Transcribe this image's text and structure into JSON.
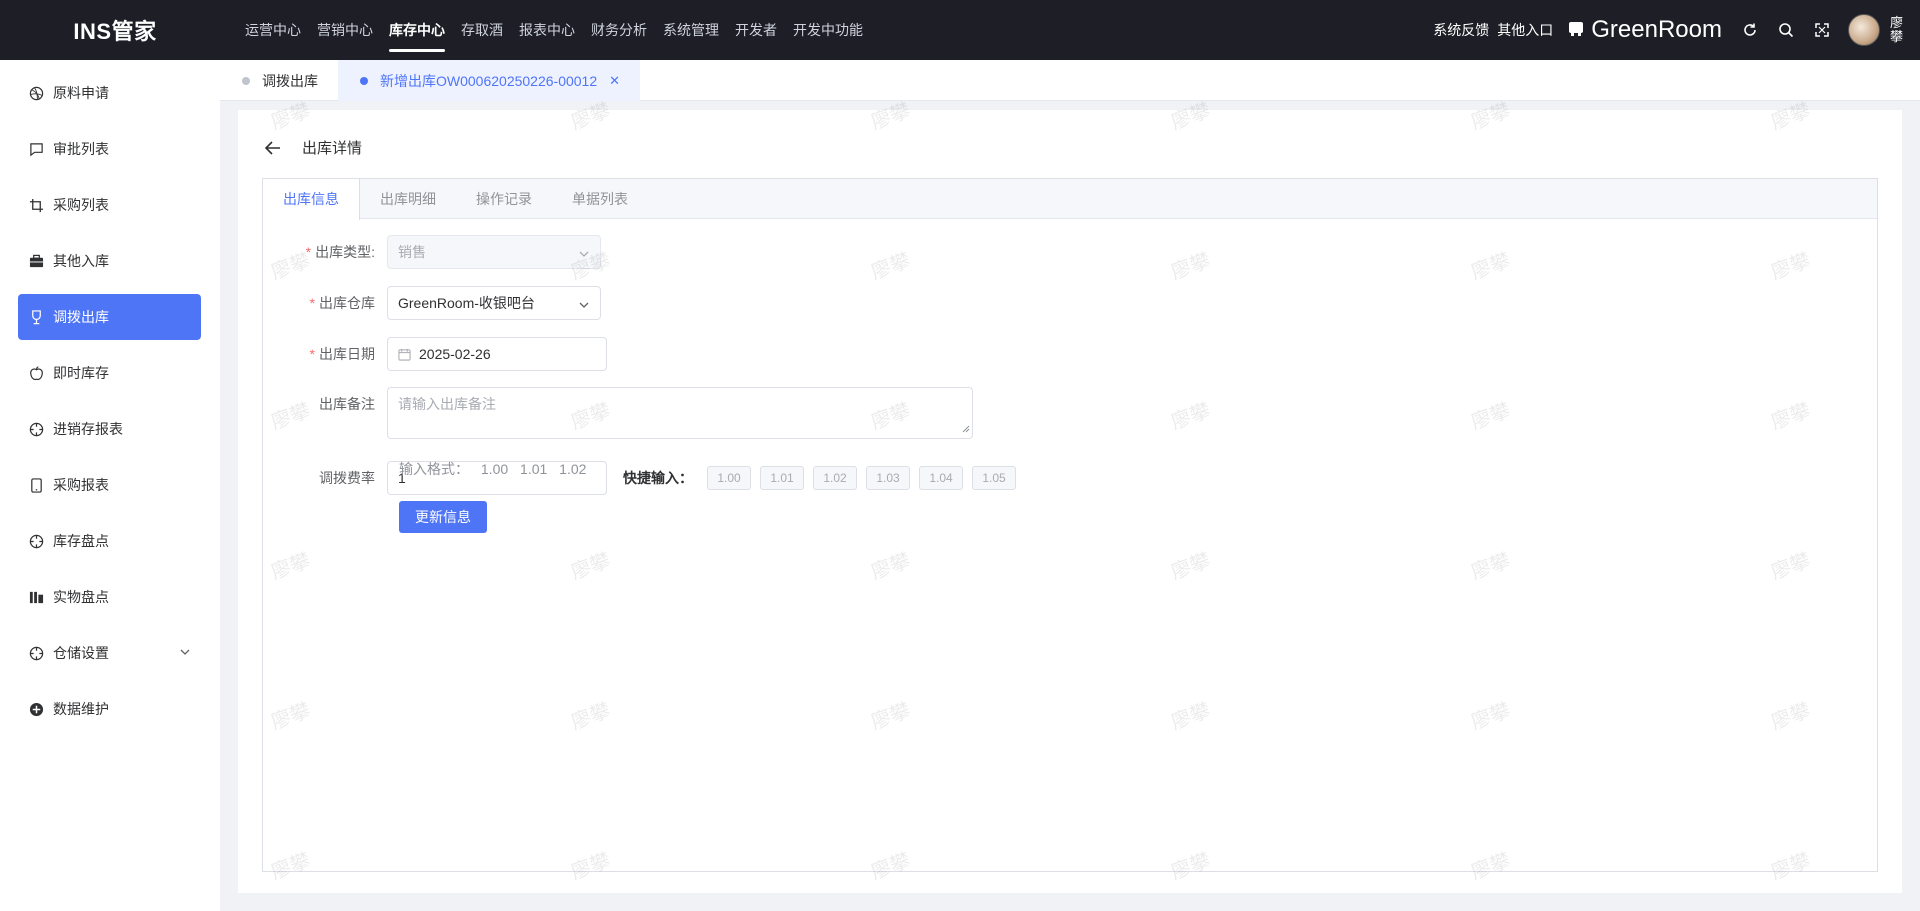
{
  "app": {
    "logo": "INS管家"
  },
  "topnav": [
    {
      "label": "运营中心",
      "active": false
    },
    {
      "label": "营销中心",
      "active": false
    },
    {
      "label": "库存中心",
      "active": true
    },
    {
      "label": "存取酒",
      "active": false
    },
    {
      "label": "报表中心",
      "active": false
    },
    {
      "label": "财务分析",
      "active": false
    },
    {
      "label": "系统管理",
      "active": false
    },
    {
      "label": "开发者",
      "active": false
    },
    {
      "label": "开发中功能",
      "active": false
    }
  ],
  "topright": {
    "feedback": "系统反馈",
    "other_entry": "其他入口",
    "store_name": "GreenRoom",
    "icons": [
      "refresh-icon",
      "search-icon",
      "fullscreen-icon"
    ],
    "user_name": "廖攀"
  },
  "sidebar": {
    "items": [
      {
        "label": "原料申请",
        "icon": "dribbble-icon",
        "active": false
      },
      {
        "label": "审批列表",
        "icon": "chat-icon",
        "active": false
      },
      {
        "label": "采购列表",
        "icon": "crop-icon",
        "active": false
      },
      {
        "label": "其他入库",
        "icon": "briefcase-icon",
        "active": false
      },
      {
        "label": "调拨出库",
        "icon": "trophy-icon",
        "active": true
      },
      {
        "label": "即时库存",
        "icon": "apple-icon",
        "active": false
      },
      {
        "label": "进销存报表",
        "icon": "target-icon",
        "active": false
      },
      {
        "label": "采购报表",
        "icon": "tablet-icon",
        "active": false
      },
      {
        "label": "库存盘点",
        "icon": "target-icon",
        "active": false
      },
      {
        "label": "实物盘点",
        "icon": "chart-icon",
        "active": false
      },
      {
        "label": "仓储设置",
        "icon": "target-icon",
        "active": false,
        "expandable": true
      },
      {
        "label": "数据维护",
        "icon": "plus-circle-icon",
        "active": false
      }
    ]
  },
  "page_tabs": [
    {
      "label": "调拨出库",
      "active": false
    },
    {
      "label": "新增出库OW000620250226-00012",
      "active": true,
      "closable": true
    }
  ],
  "detail": {
    "title": "出库详情",
    "tabs": [
      {
        "label": "出库信息",
        "active": true
      },
      {
        "label": "出库明细",
        "active": false
      },
      {
        "label": "操作记录",
        "active": false
      },
      {
        "label": "单据列表",
        "active": false
      }
    ],
    "form": {
      "type_label": "出库类型:",
      "type_value": "销售",
      "warehouse_label": "出库仓库",
      "warehouse_value": "GreenRoom-收银吧台",
      "date_label": "出库日期",
      "date_value": "2025-02-26",
      "remark_label": "出库备注",
      "remark_placeholder": "请输入出库备注",
      "rate_label": "调拨费率",
      "rate_value": "1",
      "quick_label": "快捷输入：",
      "quick_values": [
        "1.00",
        "1.01",
        "1.02",
        "1.03",
        "1.04",
        "1.05"
      ],
      "format_label": "输入格式：",
      "format_examples": [
        "1.00",
        "1.01",
        "1.02"
      ],
      "submit_label": "更新信息"
    }
  },
  "watermark_text": "廖攀"
}
